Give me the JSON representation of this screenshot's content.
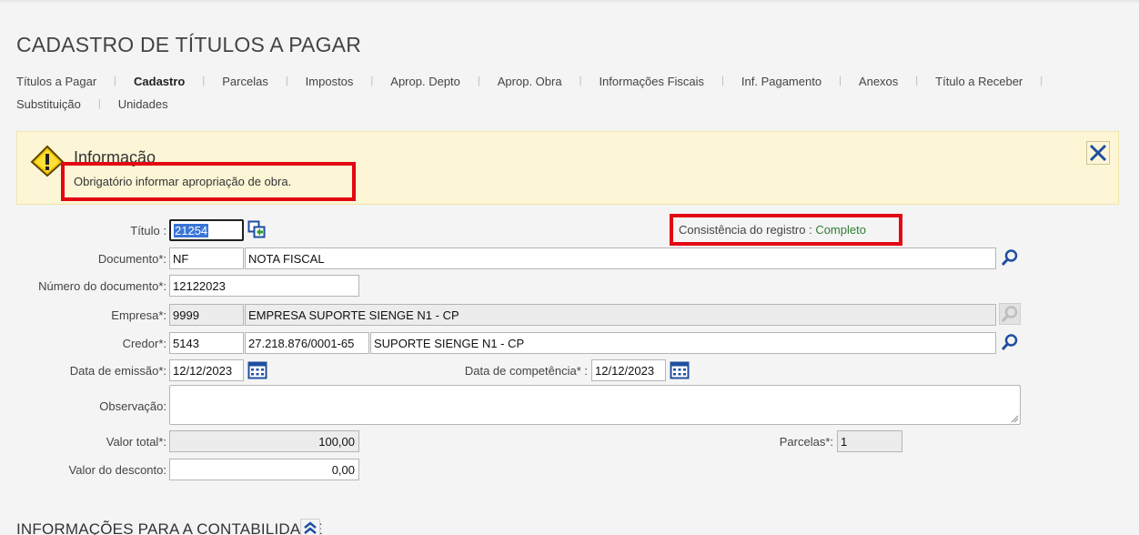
{
  "page": {
    "title": "CADASTRO DE TÍTULOS A PAGAR"
  },
  "tabs": {
    "row1": [
      "Títulos a Pagar",
      "Cadastro",
      "Parcelas",
      "Impostos",
      "Aprop. Depto",
      "Aprop. Obra",
      "Informações Fiscais",
      "Inf. Pagamento",
      "Anexos",
      "Título a Receber"
    ],
    "row2": [
      "Substituição",
      "Unidades"
    ],
    "active": "Cadastro"
  },
  "alert": {
    "title": "Informação",
    "message": "Obrigatório informar apropriação de obra.",
    "icon": "warning-icon",
    "close_icon": "close-icon"
  },
  "form": {
    "titulo": {
      "label": "Título :",
      "value": "21254"
    },
    "consistencia": {
      "label": "Consistência do registro",
      "sep": " : ",
      "value": "Completo"
    },
    "documento": {
      "label": "Documento*:",
      "code": "NF",
      "description": "NOTA FISCAL"
    },
    "numero_documento": {
      "label": "Número do documento*:",
      "value": "12122023"
    },
    "empresa": {
      "label": "Empresa*:",
      "code": "9999",
      "name": "EMPRESA SUPORTE SIENGE N1 - CP"
    },
    "credor": {
      "label": "Credor*:",
      "code": "5143",
      "cnpj": "27.218.876/0001-65",
      "name": "SUPORTE SIENGE N1 - CP"
    },
    "data_emissao": {
      "label": "Data de emissão*:",
      "value": "12/12/2023"
    },
    "data_competencia": {
      "label": "Data de competência* :",
      "value": "12/12/2023"
    },
    "observacao": {
      "label": "Observação:",
      "value": ""
    },
    "valor_total": {
      "label": "Valor total*:",
      "value": "100,00"
    },
    "parcelas": {
      "label": "Parcelas*:",
      "value": "1"
    },
    "valor_desconto": {
      "label": "Valor do desconto:",
      "value": "0,00"
    }
  },
  "section": {
    "title": "INFORMAÇÕES PARA A CONTABILIDADE"
  },
  "colors": {
    "highlight": "#e30613",
    "alert_bg": "#fcf6d6",
    "status_ok": "#2e7d32",
    "icon_blue": "#1f4fa0"
  }
}
